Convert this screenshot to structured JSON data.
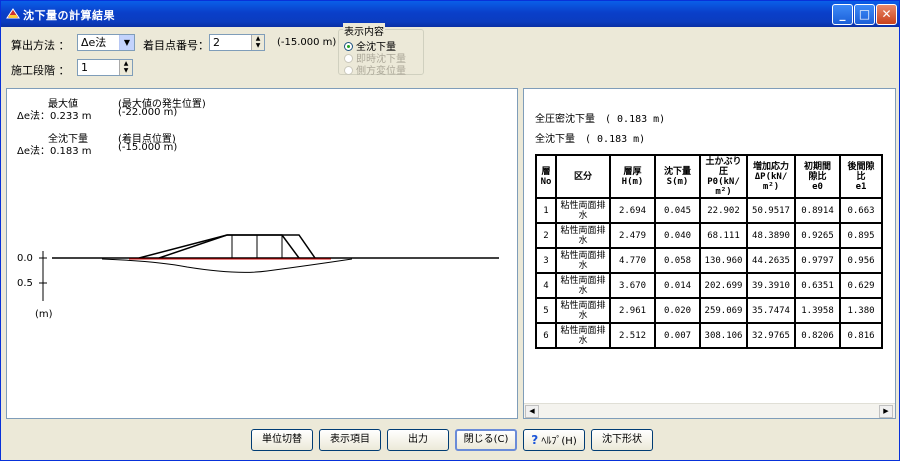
{
  "window": {
    "title": "沈下量の計算結果",
    "close_glyph": "✕",
    "min_glyph": "_",
    "max_glyph": "□"
  },
  "controls": {
    "method_label": "算出方法 ：",
    "method_value": "Δe法",
    "point_label": "着目点番号：",
    "point_value": "2",
    "point_position": "(-15.000 m)",
    "stage_label": "施工段階 ：",
    "stage_value": "1"
  },
  "display_group": {
    "title": "表示内容",
    "options": [
      {
        "label": "全沈下量",
        "selected": true,
        "enabled": true
      },
      {
        "label": "即時沈下量",
        "selected": false,
        "enabled": false
      },
      {
        "label": "側方変位量",
        "selected": false,
        "enabled": false
      }
    ]
  },
  "left_panel": {
    "max_title": "最大値",
    "max_pos_title": "(最大値の発生位置)",
    "max_value": "Δe法：0.233 m",
    "max_pos": "(-22.000 m)",
    "total_title": "全沈下量",
    "total_pos_title": "(着目点位置)",
    "total_value": "Δe法：0.183 m",
    "total_pos": "(-15.000 m)",
    "axis_ticks": [
      "0.0",
      "0.5"
    ],
    "axis_unit": "(m)"
  },
  "right_panel": {
    "consolidation_text": "全圧密沈下量　( 0.183 m)",
    "total_text": "全沈下量　( 0.183 m)",
    "columns": [
      "層\nNo",
      "区分",
      "層厚\nH(m)",
      "沈下量\nS(m)",
      "土かぶり\n圧\nP0(kN/\nm²)",
      "増加応力\nΔP(kN/\nm²)",
      "初期間\n隙比\ne0",
      "後間隙\n比\ne1"
    ],
    "rows": [
      [
        "1",
        "粘性両面排\n水",
        "2.694",
        "0.045",
        "22.902",
        "50.9517",
        "0.8914",
        "0.663"
      ],
      [
        "2",
        "粘性両面排\n水",
        "2.479",
        "0.040",
        "68.111",
        "48.3890",
        "0.9265",
        "0.895"
      ],
      [
        "3",
        "粘性両面排\n水",
        "4.770",
        "0.058",
        "130.960",
        "44.2635",
        "0.9797",
        "0.956"
      ],
      [
        "4",
        "粘性両面排\n水",
        "3.670",
        "0.014",
        "202.699",
        "39.3910",
        "0.6351",
        "0.629"
      ],
      [
        "5",
        "粘性両面排\n水",
        "2.961",
        "0.020",
        "259.069",
        "35.7474",
        "1.3958",
        "1.380"
      ],
      [
        "6",
        "粘性両面排\n水",
        "2.512",
        "0.007",
        "308.106",
        "32.9765",
        "0.8206",
        "0.816"
      ]
    ]
  },
  "buttons": {
    "unit_switch": "単位切替",
    "display_items": "表示項目",
    "output": "出力",
    "close": "閉じる(C)",
    "help": "ﾍﾙﾌﾟ(H)",
    "settlement_shape": "沈下形状"
  }
}
